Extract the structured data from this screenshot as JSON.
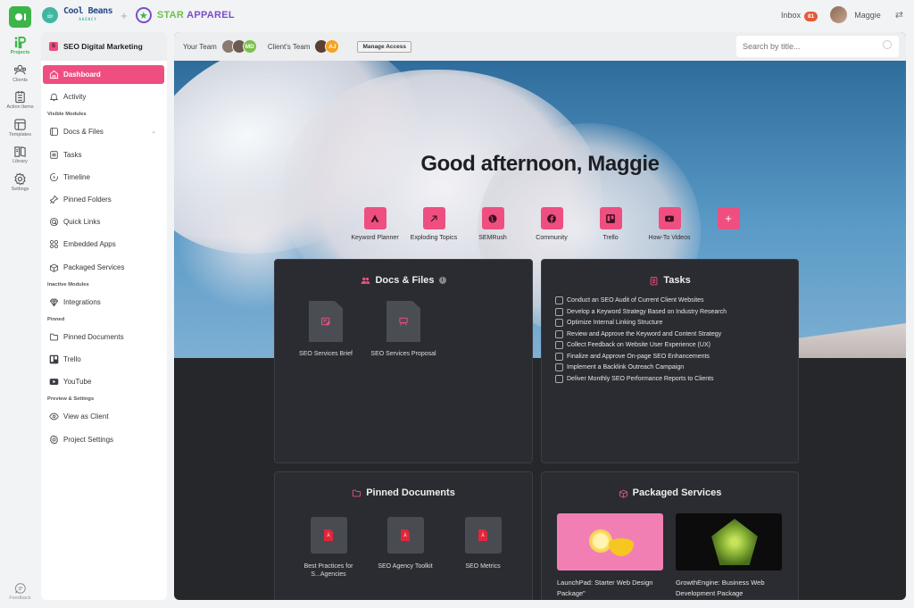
{
  "topbar": {
    "agency_name": "Cool Beans",
    "agency_sub": "AGENCY",
    "plus": "+",
    "client_name_1": "STAR",
    "client_name_2": "APPAREL",
    "inbox_label": "Inbox",
    "inbox_count": "81",
    "user_name": "Maggie"
  },
  "rail": {
    "items": [
      {
        "label": "Projects"
      },
      {
        "label": "Clients"
      },
      {
        "label": "Action Items"
      },
      {
        "label": "Templates"
      },
      {
        "label": "Library"
      },
      {
        "label": "Settings"
      }
    ],
    "feedback": "Feedback"
  },
  "sidebar": {
    "project_badge": "S",
    "project_title": "SEO Digital Marketing",
    "items": {
      "dashboard": "Dashboard",
      "activity": "Activity",
      "visible_modules": "Visible Modules",
      "docs_files": "Docs & Files",
      "tasks": "Tasks",
      "timeline": "Timeline",
      "pinned_folders": "Pinned Folders",
      "quick_links": "Quick Links",
      "embedded_apps": "Embedded Apps",
      "packaged_services": "Packaged Services",
      "inactive_modules": "Inactive Modules",
      "integrations": "Integrations",
      "pinned": "Pinned",
      "pinned_documents": "Pinned Documents",
      "trello": "Trello",
      "youtube": "YouTube",
      "preview_settings": "Preview & Settings",
      "view_as_client": "View as Client",
      "project_settings": "Project Settings"
    }
  },
  "header": {
    "your_team": "Your Team",
    "your_team_initials": "MD",
    "clients_team": "Client's Team",
    "clients_team_initials": "AJ",
    "manage_access": "Manage Access",
    "search_placeholder": "Search by title..."
  },
  "hero": {
    "greeting": "Good afternoon, Maggie",
    "quick_links": [
      {
        "label": "Keyword Planner",
        "icon": "google-ads-icon"
      },
      {
        "label": "Exploding Topics",
        "icon": "arrow-up-right-icon"
      },
      {
        "label": "SEMRush",
        "icon": "globe-icon"
      },
      {
        "label": "Community",
        "icon": "facebook-icon"
      },
      {
        "label": "Trello",
        "icon": "trello-icon"
      },
      {
        "label": "How-To Videos",
        "icon": "youtube-icon"
      },
      {
        "label": "",
        "icon": "plus-icon"
      }
    ],
    "add_symbol": "+"
  },
  "docs_files": {
    "title": "Docs & Files",
    "info": "i",
    "files": [
      {
        "label": "SEO Services Brief"
      },
      {
        "label": "SEO Services Proposal"
      }
    ]
  },
  "tasks": {
    "title": "Tasks",
    "items": [
      "Conduct an SEO Audit of Current Client Websites",
      "Develop a Keyword Strategy Based on Industry Research",
      "Optimize Internal Linking Structure",
      "Review and Approve the Keyword and Content Strategy",
      "Collect Feedback on Website User Experience (UX)",
      "Finalize and Approve On-page SEO Enhancements",
      "Implement a Backlink Outreach Campaign",
      "Deliver Monthly SEO Performance Reports to Clients"
    ]
  },
  "pinned_documents": {
    "title": "Pinned Documents",
    "docs": [
      {
        "label": "Best Practices for S...Agencies"
      },
      {
        "label": "SEO Agency Toolkit"
      },
      {
        "label": "SEO Metrics"
      }
    ]
  },
  "packaged_services": {
    "title": "Packaged Services",
    "items": [
      {
        "label": "LaunchPad: Starter Web Design Package\""
      },
      {
        "label": "GrowthEngine: Business Web Development Package"
      }
    ]
  },
  "colors": {
    "accent": "#ee4f80",
    "brand_green": "#3bb54a",
    "dark_panel": "#2a2c31"
  }
}
